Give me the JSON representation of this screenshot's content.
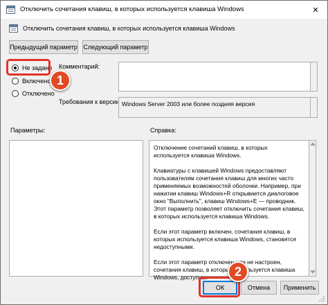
{
  "window": {
    "title": "Отключить сочетания клавиш, в которых используется клавиша Windows",
    "close_glyph": "✕"
  },
  "header": {
    "policy_name": "Отключить сочетания клавиш, в которых используется клавиша Windows"
  },
  "navigation": {
    "prev_label": "Предыдущий параметр",
    "next_label": "Следующий параметр"
  },
  "options": {
    "not_configured": "Не задано",
    "enabled": "Включено",
    "disabled": "Отключено",
    "selected": "not_configured"
  },
  "comment": {
    "label": "Комментарий:",
    "value": ""
  },
  "supported": {
    "label": "Требования к версии:",
    "value": "Windows Server 2003 или более поздняя версия"
  },
  "params": {
    "label": "Параметры:"
  },
  "help": {
    "label": "Справка:",
    "paragraphs": [
      "Отключение сочетаний клавиш, в которых используется клавиша Windows.",
      "Клавиатуры с клавишей Windows предоставляют пользователям сочетания клавиш для многих часто применяемых возможностей оболочки. Например, при нажатии клавиш Windows+R открывается диалоговое окно \"Выполнить\", клавиш Windows+E — проводник. Этот параметр позволяет отключить сочетания клавиш, в которых используется клавиша Windows.",
      "Если этот параметр включен, сочетания клавиш, в которых используется клавиша Windows, становятся недоступными.",
      "Если этот параметр отключен или не настроен, сочетания клавиш, в которых используется клавиша Windows, доступны."
    ]
  },
  "footer": {
    "ok_label": "ОК",
    "cancel_label": "Отмена",
    "apply_label": "Применить"
  },
  "annotations": {
    "step1": "1",
    "step2": "2",
    "color": "#e1322a"
  }
}
